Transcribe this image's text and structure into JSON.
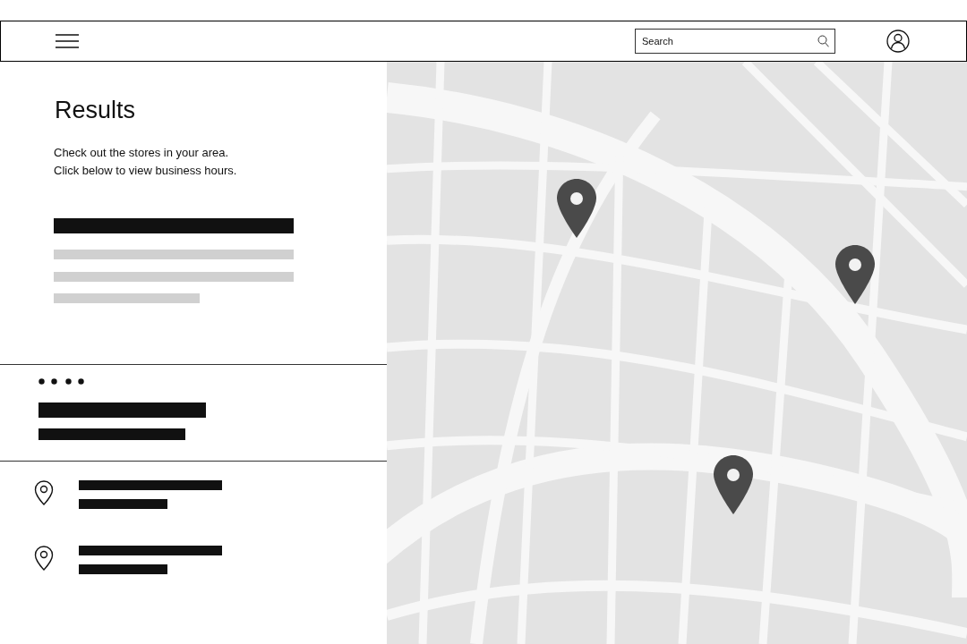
{
  "header": {
    "search": {
      "placeholder": "Search"
    }
  },
  "results": {
    "title": "Results",
    "lines": [
      "Check out the stores in your area.",
      "Click below to view business hours."
    ]
  }
}
